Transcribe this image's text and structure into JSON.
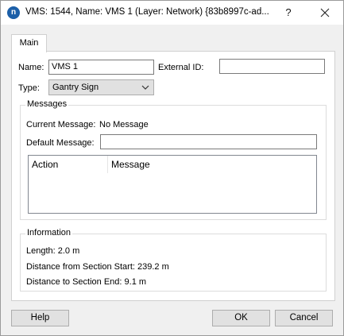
{
  "window": {
    "title": "VMS: 1544, Name: VMS 1 (Layer: Network) {83b8997c-ad...",
    "app_icon_letter": "n",
    "help_glyph": "?"
  },
  "tabs": [
    {
      "label": "Main",
      "selected": true
    }
  ],
  "form": {
    "name_label": "Name:",
    "name_value": "VMS 1",
    "external_id_label": "External ID:",
    "external_id_value": "",
    "type_label": "Type:",
    "type_value": "Gantry Sign"
  },
  "messages": {
    "group_title": "Messages",
    "current_label": "Current Message:",
    "current_value": "No Message",
    "default_label": "Default Message:",
    "default_value": "",
    "columns": [
      "Action",
      "Message"
    ]
  },
  "information": {
    "group_title": "Information",
    "length": "Length: 2.0 m",
    "distance_from_start": "Distance from Section Start: 239.2 m",
    "distance_to_end": "Distance to Section End: 9.1 m"
  },
  "buttons": {
    "help": "Help",
    "ok": "OK",
    "cancel": "Cancel"
  },
  "colors": {
    "app_icon": "#1c5fa8",
    "dialog_bg": "#f0f0f0",
    "panel_bg": "#ffffff"
  },
  "icons": {
    "app": "app-logo-icon",
    "close": "close-icon",
    "dropdown": "chevron-down-icon"
  }
}
